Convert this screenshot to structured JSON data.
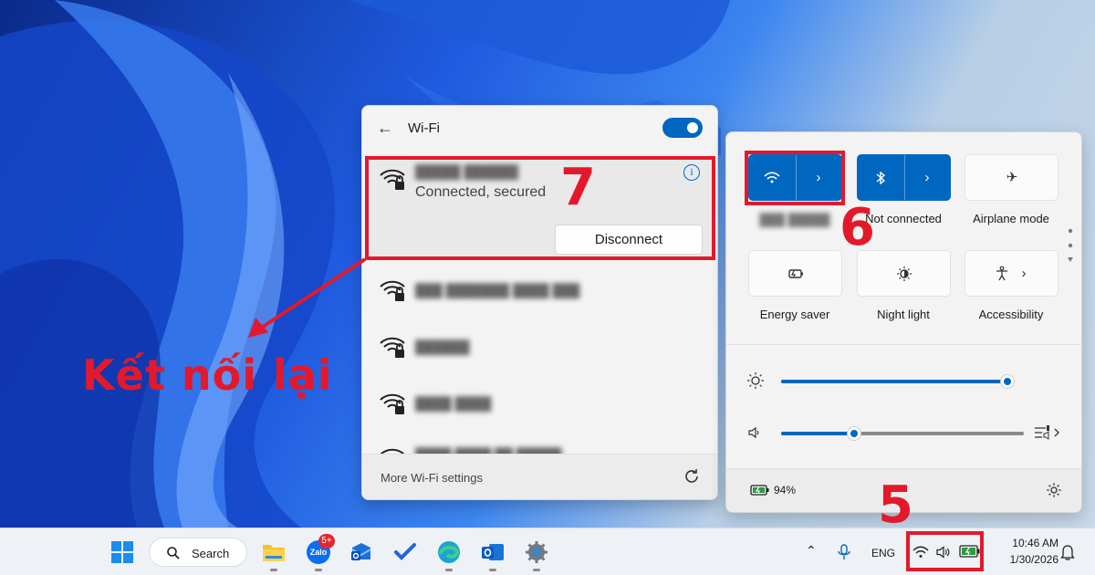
{
  "wifi_panel": {
    "title": "Wi-Fi",
    "toggle_on": true,
    "connected_network": {
      "status": "Connected, secured",
      "disconnect_label": "Disconnect",
      "info_glyph": "i"
    },
    "footer_label": "More Wi-Fi settings"
  },
  "quick_settings": {
    "bluetooth_label": "Not connected",
    "airplane_label": "Airplane mode",
    "energy_saver_label": "Energy saver",
    "night_light_label": "Night light",
    "accessibility_label": "Accessibility",
    "brightness_level": 0.97,
    "volume_level": 0.3,
    "battery_percent": "94%"
  },
  "taskbar": {
    "search_label": "Search",
    "zalo_badge": "5+",
    "language": "ENG",
    "time": "10:46 AM",
    "date": "1/30/2026"
  },
  "annotations": {
    "step_5": "5",
    "step_6": "6",
    "step_7": "7",
    "reconnect_label": "Kết nối lại"
  },
  "colors": {
    "accent": "#0067c0",
    "annotation_red": "#e3192b"
  }
}
